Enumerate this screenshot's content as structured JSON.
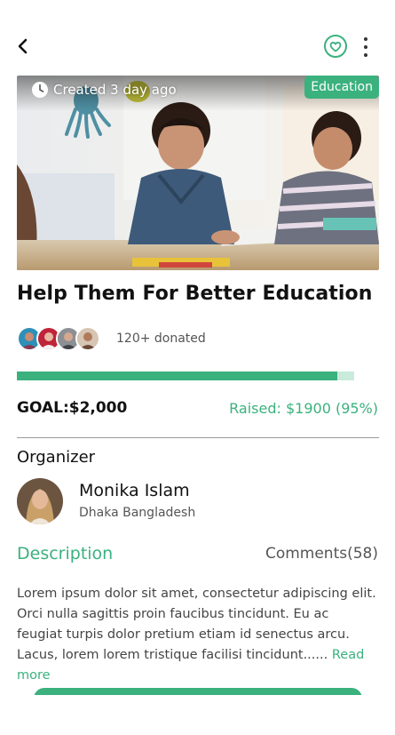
{
  "header": {
    "back_icon": "chevron-left-icon",
    "favorite_icon": "heart-circle-icon",
    "more_icon": "vertical-dots-icon"
  },
  "hero": {
    "created_text": "Created 3 day ago",
    "category": "Education",
    "image": "children-drawing-classroom-photo"
  },
  "campaign": {
    "title": "Help Them For Better Education",
    "donated_text": "120+ donated",
    "progress_fraction": 0.95,
    "goal_text": "GOAL:$2,000",
    "raised_text": "Raised: $1900 (95%)"
  },
  "organizer": {
    "heading": "Organizer",
    "name": "Monika Islam",
    "location": "Dhaka Bangladesh"
  },
  "tabs": {
    "description": "Description",
    "comments": "Comments(58)"
  },
  "description": {
    "text": "Lorem ipsum dolor sit amet, consectetur adipiscing elit. Orci nulla sagittis proin faucibus tincidunt. Eu ac feugiat turpis dolor pretium etiam id senectus arcu. Lacus, lorem lorem tristique facilisi tincidunt...... ",
    "read_more": "Read more"
  },
  "colors": {
    "accent": "#3bb17e",
    "accent_light": "#c9ebdb"
  }
}
